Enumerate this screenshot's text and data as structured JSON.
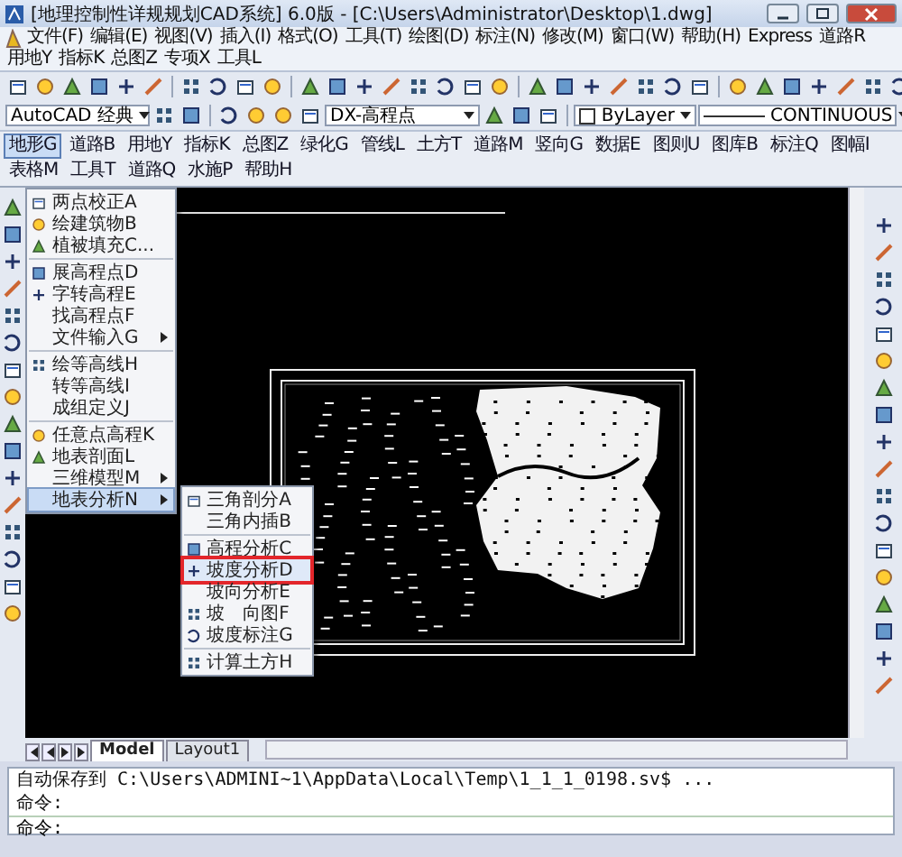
{
  "window": {
    "title": "[地理控制性详规规划CAD系统] 6.0版 - [C:\\Users\\Administrator\\Desktop\\1.dwg]"
  },
  "menu_bar": [
    "文件(F)",
    "编辑(E)",
    "视图(V)",
    "插入(I)",
    "格式(O)",
    "工具(T)",
    "绘图(D)",
    "标注(N)",
    "修改(M)",
    "窗口(W)",
    "帮助(H)",
    "Express",
    "道路R",
    "用地Y",
    "指标K",
    "总图Z",
    "专项X",
    "工具L"
  ],
  "toolbar": {
    "workspace": "AutoCAD 经典",
    "layer": "DX-高程点",
    "property_dropdown": "ByLayer",
    "linetype": "CONTINUOUS"
  },
  "app_menu": [
    {
      "label": "地形G",
      "selected": true
    },
    {
      "label": "道路B",
      "selected": false
    },
    {
      "label": "用地Y",
      "selected": false
    },
    {
      "label": "指标K",
      "selected": false
    },
    {
      "label": "总图Z",
      "selected": false
    },
    {
      "label": "绿化G",
      "selected": false
    },
    {
      "label": "管线L",
      "selected": false
    },
    {
      "label": "土方T",
      "selected": false
    },
    {
      "label": "道路M",
      "selected": false
    },
    {
      "label": "竖向G",
      "selected": false
    },
    {
      "label": "数据E",
      "selected": false
    },
    {
      "label": "图则U",
      "selected": false
    },
    {
      "label": "图库B",
      "selected": false
    },
    {
      "label": "标注Q",
      "selected": false
    },
    {
      "label": "图幅I",
      "selected": false
    },
    {
      "label": "表格M",
      "selected": false
    },
    {
      "label": "工具T",
      "selected": false
    },
    {
      "label": "道路Q",
      "selected": false
    },
    {
      "label": "水施P",
      "selected": false
    },
    {
      "label": "帮助H",
      "selected": false
    }
  ],
  "dropdown": [
    [
      {
        "label": "两点校正A",
        "has_icon": true,
        "has_submenu": false,
        "selected": false
      },
      {
        "label": "绘建筑物B",
        "has_icon": true,
        "has_submenu": false,
        "selected": false
      },
      {
        "label": "植被填充C...",
        "has_icon": true,
        "has_submenu": false,
        "selected": false
      }
    ],
    [
      {
        "label": "展高程点D",
        "has_icon": true,
        "has_submenu": false,
        "selected": false
      },
      {
        "label": "字转高程E",
        "has_icon": true,
        "has_submenu": false,
        "selected": false
      },
      {
        "label": "找高程点F",
        "has_icon": false,
        "has_submenu": false,
        "selected": false
      },
      {
        "label": "文件输入G",
        "has_icon": false,
        "has_submenu": true,
        "selected": false
      }
    ],
    [
      {
        "label": "绘等高线H",
        "has_icon": true,
        "has_submenu": false,
        "selected": false
      },
      {
        "label": "转等高线I",
        "has_icon": false,
        "has_submenu": false,
        "selected": false
      },
      {
        "label": "成组定义J",
        "has_icon": false,
        "has_submenu": false,
        "selected": false
      }
    ],
    [
      {
        "label": "任意点高程K",
        "has_icon": true,
        "has_submenu": false,
        "selected": false
      },
      {
        "label": "地表剖面L",
        "has_icon": true,
        "has_submenu": false,
        "selected": false
      },
      {
        "label": "三维模型M",
        "has_icon": false,
        "has_submenu": true,
        "selected": false
      },
      {
        "label": "地表分析N",
        "has_icon": false,
        "has_submenu": true,
        "selected": true
      }
    ]
  ],
  "submenu": [
    [
      {
        "label": "三角剖分A",
        "has_icon": true,
        "selected": false
      },
      {
        "label": "三角内插B",
        "has_icon": false,
        "selected": false
      }
    ],
    [
      {
        "label": "高程分析C",
        "has_icon": true,
        "selected": false
      },
      {
        "label": "坡度分析D",
        "has_icon": true,
        "selected": true
      },
      {
        "label": "坡向分析E",
        "has_icon": false,
        "selected": false
      },
      {
        "label": "坡　向图F",
        "has_icon": true,
        "selected": false
      },
      {
        "label": "坡度标注G",
        "has_icon": true,
        "selected": false
      }
    ],
    [
      {
        "label": "计算土方H",
        "has_icon": true,
        "selected": false
      }
    ]
  ],
  "layout_tabs": [
    {
      "label": "Model",
      "selected": true
    },
    {
      "label": "Layout1",
      "selected": false
    }
  ],
  "command_history": [
    "自动保存到 C:\\Users\\ADMINI~1\\AppData\\Local\\Temp\\1_1_1_0198.sv$ ...",
    "命令:"
  ],
  "command_prompt": "命令:"
}
